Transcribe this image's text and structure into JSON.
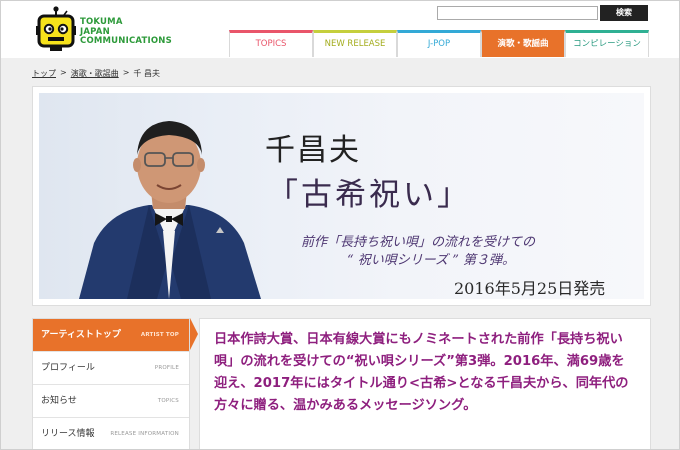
{
  "header": {
    "logo_text_lines": [
      "TOKUMA",
      "JAPAN",
      "COMMUNICATIONS"
    ],
    "search": {
      "value": "",
      "placeholder": "",
      "button_label": "検索"
    },
    "nav_tabs": [
      {
        "label": "TOPICS",
        "color": "#e9556a"
      },
      {
        "label": "NEW RELEASE",
        "color": "#c5cf3c"
      },
      {
        "label": "J-POP",
        "color": "#33a9d6"
      },
      {
        "label": "演歌・歌謡曲",
        "color": "#e8722a",
        "active": true
      },
      {
        "label": "コンピレーション",
        "color": "#2fb093"
      }
    ]
  },
  "breadcrumb": {
    "items": [
      "トップ",
      "演歌・歌謡曲",
      "千 昌夫"
    ],
    "separator": ">"
  },
  "banner": {
    "artist": "千昌夫",
    "title": "「古希祝い」",
    "subtitle_line1": "前作「長持ち祝い唄」の流れを受けての",
    "subtitle_line2": "“ 祝い唄シリーズ ” 第３弾。",
    "release_date": "2016年5月25日発売"
  },
  "sidebar": {
    "items": [
      {
        "label": "アーティストトップ",
        "en": "ARTIST TOP",
        "active": true
      },
      {
        "label": "プロフィール",
        "en": "PROFILE"
      },
      {
        "label": "お知らせ",
        "en": "TOPICS"
      },
      {
        "label": "リリース情報",
        "en": "RELEASE INFORMATION"
      }
    ]
  },
  "main": {
    "lead_text": "日本作詩大賞、日本有線大賞にもノミネートされた前作「長持ち祝い唄」の流れを受けての“祝い唄シリーズ”第3弾。2016年、満69歳を迎え、2017年にはタイトル通り<古希>となる千昌夫から、同年代の方々に贈る、温かみあるメッセージソング。"
  },
  "colors": {
    "accent_orange": "#e8722a",
    "lead_purple": "#8e1f7e",
    "logo_green": "#2d9a3a"
  }
}
